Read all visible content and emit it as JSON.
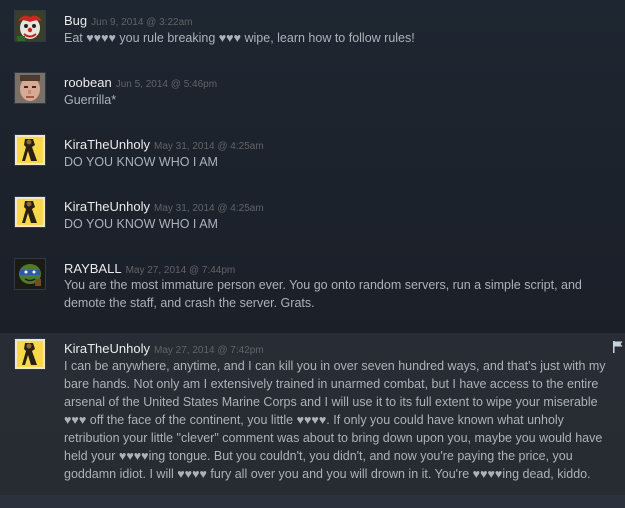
{
  "comments": [
    {
      "author": "Bug",
      "timestamp": "Jun 9, 2014 @ 3:22am",
      "text": "Eat ♥♥♥♥ you rule breaking ♥♥♥ wipe, learn how to follow rules!",
      "avatar": "clown-avatar"
    },
    {
      "author": "roobean",
      "timestamp": "Jun 5, 2014 @ 5:46pm",
      "text": "Guerrilla*",
      "avatar": "face-avatar"
    },
    {
      "author": "KiraTheUnholy",
      "timestamp": "May 31, 2014 @ 4:25am",
      "text": "DO YOU KNOW WHO I AM",
      "avatar": "yellow-figure-avatar"
    },
    {
      "author": "KiraTheUnholy",
      "timestamp": "May 31, 2014 @ 4:25am",
      "text": "DO YOU KNOW WHO I AM",
      "avatar": "yellow-figure-avatar"
    },
    {
      "author": "RAYBALL",
      "timestamp": "May 27, 2014 @ 7:44pm",
      "text": "You are the most immature person ever. You go onto random servers, run a simple script, and demote the staff, and crash the server. Grats.",
      "avatar": "turtle-avatar"
    },
    {
      "author": "KiraTheUnholy",
      "timestamp": "May 27, 2014 @ 7:42pm",
      "text": "I can be anywhere, anytime, and I can kill you in over seven hundred ways, and that's just with my bare hands. Not only am I extensively trained in unarmed combat, but I have access to the entire arsenal of the United States Marine Corps and I will use it to its full extent to wipe your miserable ♥♥♥ off the face of the continent, you little ♥♥♥♥. If only you could have known what unholy retribution your little \"clever\" comment was about to bring down upon you, maybe you would have held your ♥♥♥♥ing tongue. But you couldn't, you didn't, and now you're paying the price, you goddamn idiot. I will ♥♥♥♥ fury all over you and you will drown in it. You're ♥♥♥♥ing dead, kiddo.",
      "avatar": "yellow-figure-avatar"
    }
  ],
  "icons": {
    "report_flag": "flag-icon"
  },
  "colors": {
    "background": "#1b2029",
    "author": "#ebebeb",
    "timestamp": "#626366",
    "text": "#acb2b8"
  }
}
